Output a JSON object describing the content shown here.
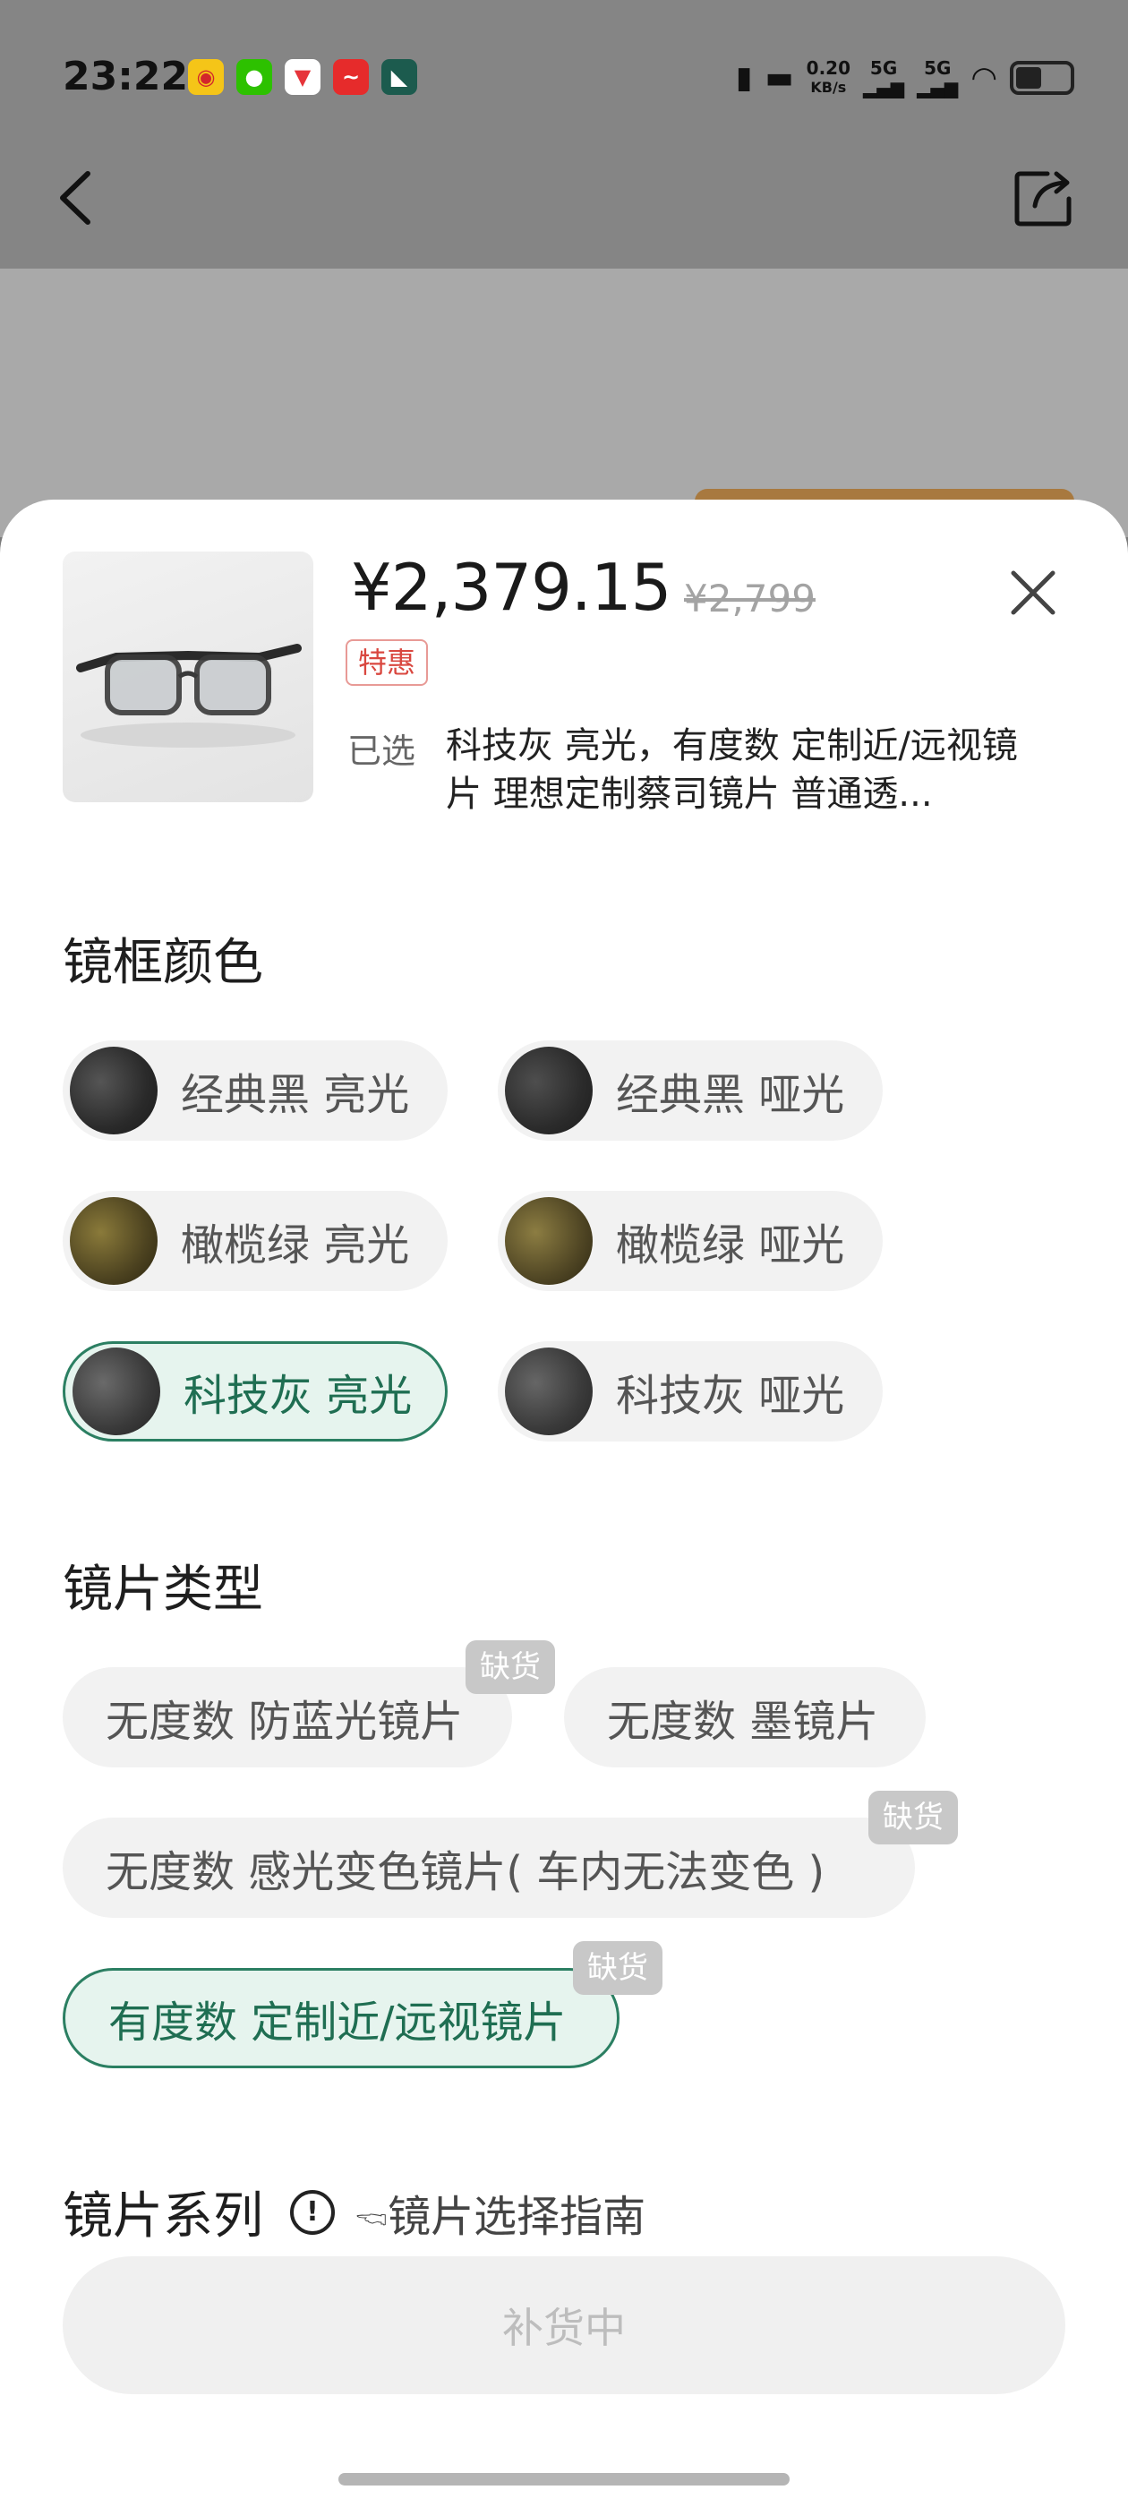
{
  "status_bar": {
    "time": "23:22",
    "apps": [
      {
        "icon": "weibo-icon",
        "color": "#f5c518",
        "glyph": "◉"
      },
      {
        "icon": "wechat-icon",
        "color": "#2dc100",
        "glyph": "●"
      },
      {
        "icon": "app-red-arrow-icon",
        "color": "#ffffff",
        "glyph": "▼"
      },
      {
        "icon": "stock-app-icon",
        "color": "#e62b2b",
        "glyph": "~"
      },
      {
        "icon": "app-green-icon",
        "color": "#1c5b4e",
        "glyph": "◣"
      }
    ],
    "net_speed_value": "0.20",
    "net_speed_unit": "KB/s",
    "sig1": "5G",
    "sig2": "5G"
  },
  "header": {
    "back_icon": "back-arrow-icon",
    "share_icon": "share-icon"
  },
  "product": {
    "price": "¥2,379.15",
    "original_price": "¥2,799",
    "tag": "特惠",
    "selected_label": "已选",
    "selected_text": "科技灰 亮光，有度数 定制近/远视镜片 理想定制蔡司镜片 普通透..."
  },
  "frame_color": {
    "title": "镜框颜色",
    "options": [
      {
        "label": "经典黑 亮光",
        "selected": false
      },
      {
        "label": "经典黑 哑光",
        "selected": false
      },
      {
        "label": "橄榄绿 亮光",
        "selected": false
      },
      {
        "label": "橄榄绿 哑光",
        "selected": false
      },
      {
        "label": "科技灰 亮光",
        "selected": true
      },
      {
        "label": "科技灰 哑光",
        "selected": false
      }
    ]
  },
  "lens_type": {
    "title": "镜片类型",
    "oos_label": "缺货",
    "options": [
      {
        "label": "无度数 防蓝光镜片",
        "out_of_stock": true,
        "selected": false
      },
      {
        "label": "无度数 墨镜片",
        "out_of_stock": false,
        "selected": false
      },
      {
        "label": "无度数 感光变色镜片( 车内无法变色 )",
        "out_of_stock": true,
        "selected": false
      },
      {
        "label": "有度数 定制近/远视镜片",
        "out_of_stock": true,
        "selected": true
      }
    ]
  },
  "lens_series": {
    "title": "镜片系列",
    "info_glyph": "!",
    "guide": "🖘镜片选择指南"
  },
  "footer": {
    "button": "补货中"
  }
}
